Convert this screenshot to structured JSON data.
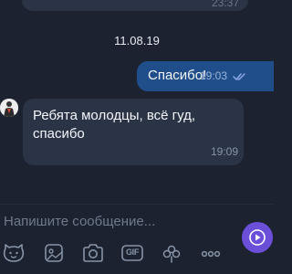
{
  "chat": {
    "previous_message": {
      "time": "23:37"
    },
    "date_separator": "11.08.19",
    "outgoing_message": {
      "text": "Спасибо!",
      "time": "19:03",
      "status_icon": "double-check-icon"
    },
    "incoming_message": {
      "text": "Ребята молодцы, всё гуд, спасибо",
      "time": "19:09",
      "avatar_icon": "avatar"
    }
  },
  "composer": {
    "placeholder": "Напишите сообщение...",
    "toolbar": [
      {
        "icon": "emoji-icon"
      },
      {
        "icon": "sticker-icon"
      },
      {
        "icon": "camera-icon"
      },
      {
        "icon": "gif-icon",
        "label": "GIF"
      },
      {
        "icon": "flower-icon"
      },
      {
        "icon": "more-icon"
      }
    ],
    "send_icon": "send-icon"
  },
  "colors": {
    "background": "#1c2230",
    "incoming_bubble": "#2b3446",
    "outgoing_bubble": "#1f4e8a",
    "accent": "#6b4fd9"
  }
}
